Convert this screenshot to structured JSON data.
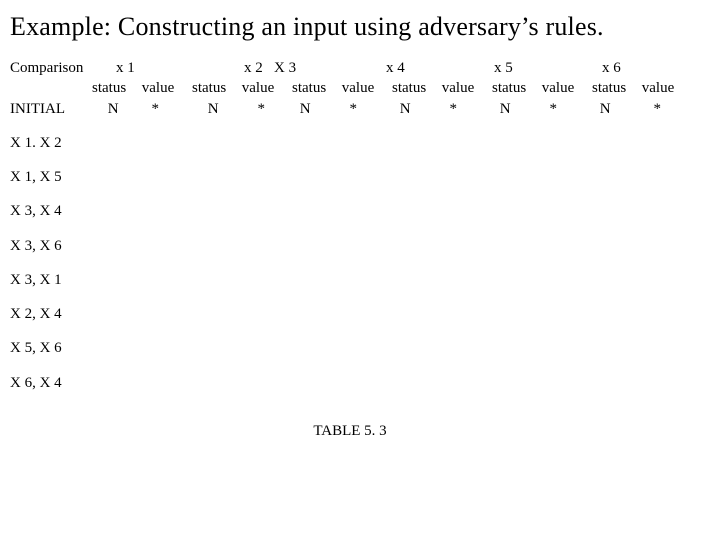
{
  "title": "Example: Constructing an input using  adversary’s rules.",
  "header": {
    "comparison": "Comparison",
    "cols": [
      "x 1",
      "x 2",
      "X 3",
      "x 4",
      "x 5",
      "x 6"
    ],
    "sub": {
      "status": "status",
      "value": "value"
    }
  },
  "initial": {
    "label": "INITIAL",
    "cells": [
      {
        "status": "N",
        "value": "*"
      },
      {
        "status": "N",
        "value": "*"
      },
      {
        "status": "N",
        "value": "*"
      },
      {
        "status": "N",
        "value": "*"
      },
      {
        "status": "N",
        "value": "*"
      },
      {
        "status": "N",
        "value": "*"
      }
    ]
  },
  "rows": [
    "X 1. X 2",
    "X 1, X 5",
    "X 3, X 4",
    "X 3, X 6",
    "X 3, X 1",
    "X 2, X 4",
    "X 5, X 6",
    "X 6, X 4"
  ],
  "caption": "TABLE 5. 3"
}
